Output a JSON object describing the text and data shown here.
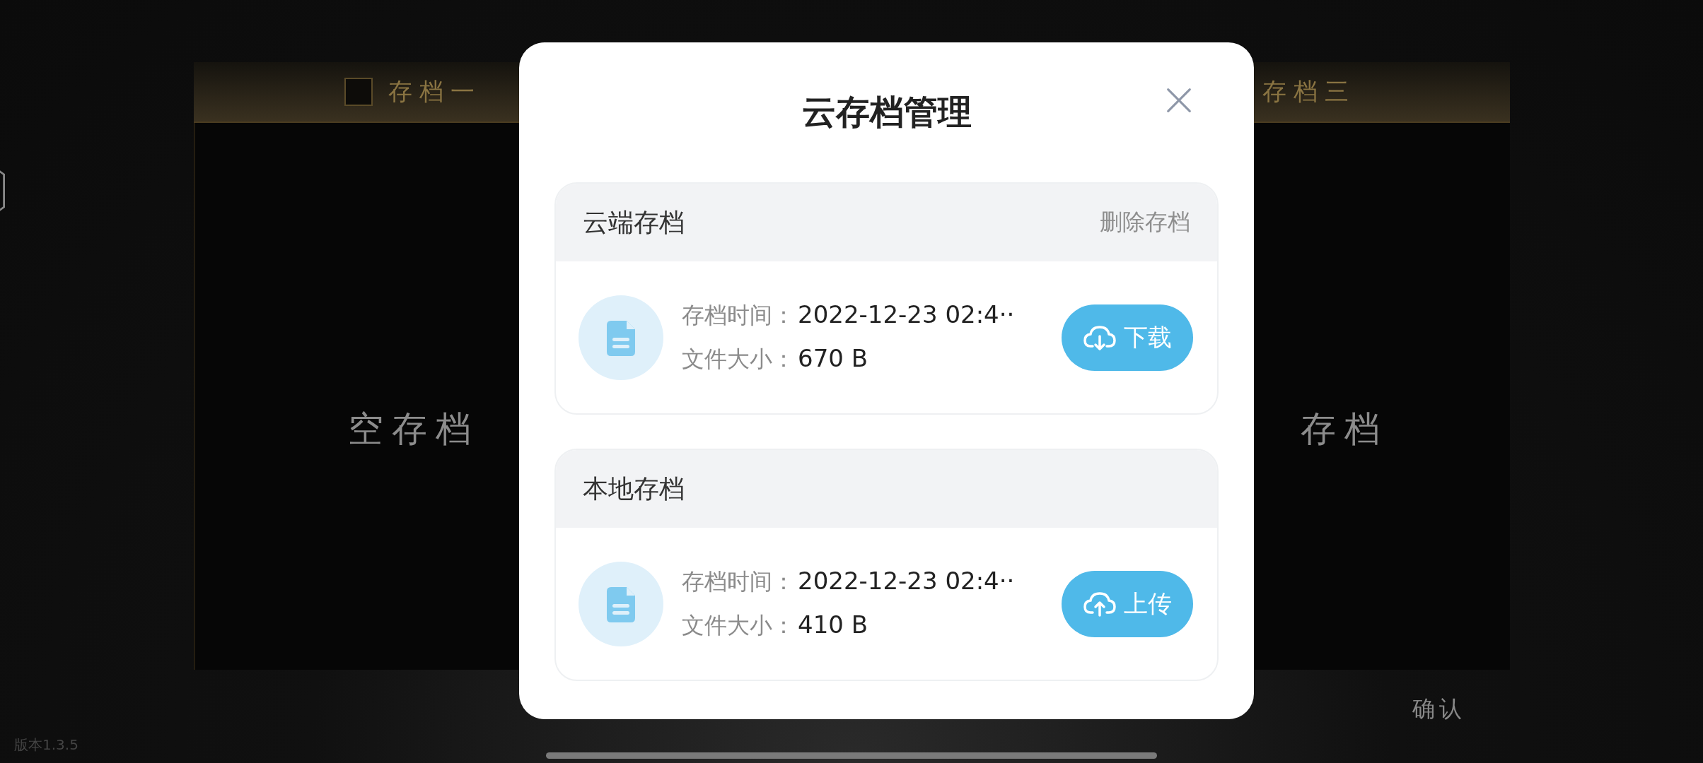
{
  "game": {
    "left_slot": {
      "label": "存档一",
      "checked": false,
      "status": "空存档"
    },
    "right_slot": {
      "label": "存档三",
      "status": "存档"
    },
    "confirm": "确认",
    "version": "版本1.3.5"
  },
  "dialog": {
    "title": "云存档管理",
    "sections": [
      {
        "title": "云端存档",
        "action": "删除存档",
        "time_label": "存档时间：",
        "time": "2022-12-23 02:4··",
        "size_label": "文件大小：",
        "size": "670 B",
        "button": {
          "kind": "download",
          "label": "下载"
        }
      },
      {
        "title": "本地存档",
        "time_label": "存档时间：",
        "time": "2022-12-23 02:4··",
        "size_label": "文件大小：",
        "size": "410 B",
        "button": {
          "kind": "upload",
          "label": "上传"
        }
      }
    ]
  }
}
